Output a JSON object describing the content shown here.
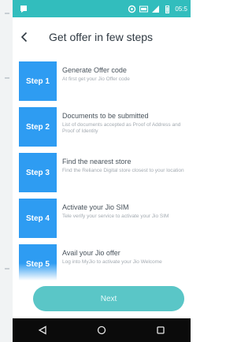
{
  "status_bar": {
    "time": "05:5",
    "icons": [
      "app-notification-icon",
      "signal-icon",
      "volte-icon",
      "wifi-icon",
      "battery-icon"
    ]
  },
  "app_bar": {
    "title": "Get offer in few steps",
    "back_icon": "chevron-left-icon"
  },
  "steps": [
    {
      "badge": "Step 1",
      "title": "Generate Offer code",
      "description": "At first get your Jio Offer code"
    },
    {
      "badge": "Step 2",
      "title": "Documents to be submitted",
      "description": "List of documents accepted as Proof of Address and Proof of Identity"
    },
    {
      "badge": "Step 3",
      "title": "Find the nearest store",
      "description": "Find the Reliance Digital store closest to your location"
    },
    {
      "badge": "Step 4",
      "title": "Activate your Jio SIM",
      "description": "Tele verify your service to activate your Jio SIM"
    },
    {
      "badge": "Step 5",
      "title": "Avail your Jio offer",
      "description": "Log into MyJio to activate your Jio Welcome"
    }
  ],
  "next_button": {
    "label": "Next"
  },
  "nav_bar": {
    "icons": [
      "back-triangle-icon",
      "home-circle-icon",
      "recents-square-icon"
    ]
  },
  "colors": {
    "status_bar": "#32bdbd",
    "step_badge": "#2e9cf2",
    "next_button": "#5ac6c7",
    "nav_bar": "#0b0b0b"
  }
}
